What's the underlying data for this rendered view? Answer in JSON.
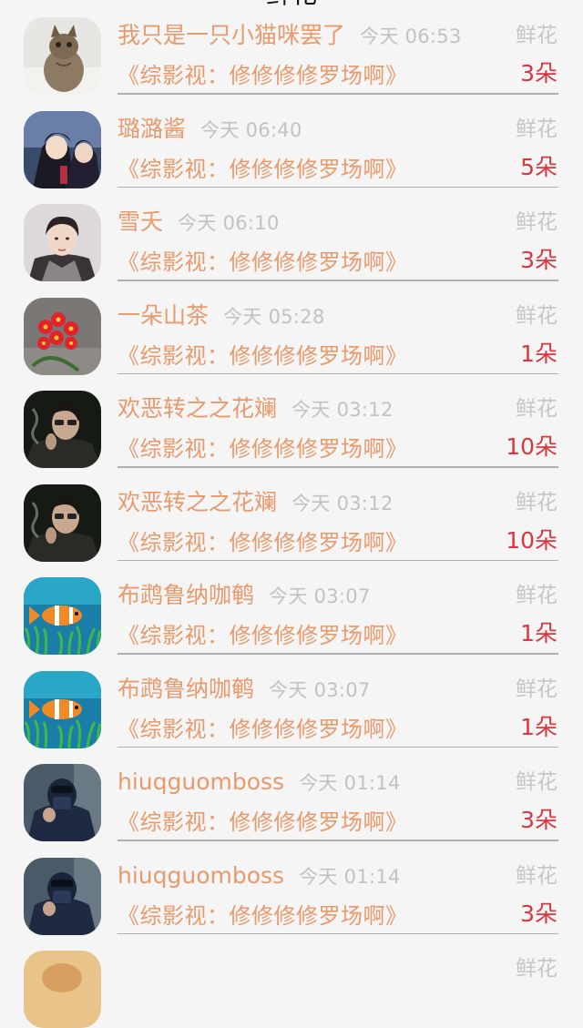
{
  "header": {
    "title": "鲜花"
  },
  "rows": [
    {
      "name": "我只是一只小猫咪罢了",
      "time": "今天 06:53",
      "type": "鲜花",
      "book": "《综影视：修修修修罗场啊》",
      "count": "3朵",
      "avatar": "cat"
    },
    {
      "name": "璐潞酱",
      "time": "今天 06:40",
      "type": "鲜花",
      "book": "《综影视：修修修修罗场啊》",
      "count": "5朵",
      "avatar": "anime"
    },
    {
      "name": "雪夭",
      "time": "今天 06:10",
      "type": "鲜花",
      "book": "《综影视：修修修修罗场啊》",
      "count": "3朵",
      "avatar": "portrait"
    },
    {
      "name": "一朵山茶",
      "time": "今天 05:28",
      "type": "鲜花",
      "book": "《综影视：修修修修罗场啊》",
      "count": "1朵",
      "avatar": "flowers"
    },
    {
      "name": "欢恶转之之花斓",
      "time": "今天 03:12",
      "type": "鲜花",
      "book": "《综影视：修修修修罗场啊》",
      "count": "10朵",
      "avatar": "smoker"
    },
    {
      "name": "欢恶转之之花斓",
      "time": "今天 03:12",
      "type": "鲜花",
      "book": "《综影视：修修修修罗场啊》",
      "count": "10朵",
      "avatar": "smoker"
    },
    {
      "name": "布鹉鲁纳咖鹌",
      "time": "今天 03:07",
      "type": "鲜花",
      "book": "《综影视：修修修修罗场啊》",
      "count": "1朵",
      "avatar": "fish"
    },
    {
      "name": "布鹉鲁纳咖鹌",
      "time": "今天 03:07",
      "type": "鲜花",
      "book": "《综影视：修修修修罗场啊》",
      "count": "1朵",
      "avatar": "fish"
    },
    {
      "name": "hiuqguomboss",
      "time": "今天 01:14",
      "type": "鲜花",
      "book": "《综影视：修修修修罗场啊》",
      "count": "3朵",
      "avatar": "hood"
    },
    {
      "name": "hiuqguomboss",
      "time": "今天 01:14",
      "type": "鲜花",
      "book": "《综影视：修修修修罗场啊》",
      "count": "3朵",
      "avatar": "hood"
    },
    {
      "name": "",
      "time": "",
      "type": "鲜花",
      "book": "",
      "count": "",
      "avatar": "partial"
    }
  ]
}
